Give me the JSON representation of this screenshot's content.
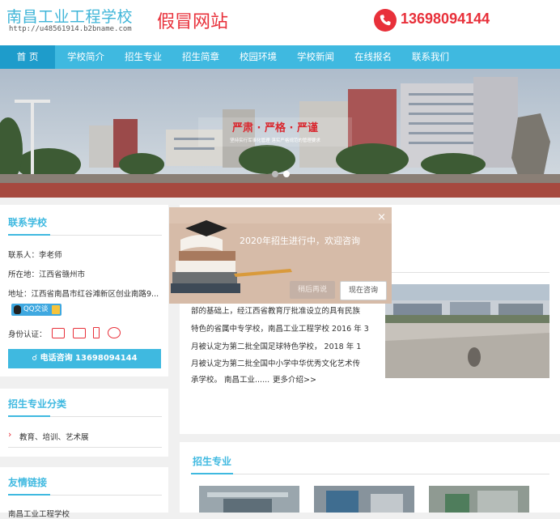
{
  "header": {
    "school_name": "南昌工业工程学校",
    "site_url": "http://u48561914.b2bname.com",
    "fake_site_label": "假冒网站",
    "phone_number": "13698094144"
  },
  "nav": {
    "items": [
      "首 页",
      "学校简介",
      "招生专业",
      "招生简章",
      "校园环境",
      "学校新闻",
      "在线报名",
      "联系我们"
    ]
  },
  "banner": {
    "slogan": "严肃 · 严格 · 严谨",
    "subtitle": "坚持实行军事化管理 落实严格规范的管理要求"
  },
  "contact": {
    "title": "联系学校",
    "contact_person": "联系人：李老师",
    "location": "所在地：江西省赣州市",
    "address": "地址：江西省南昌市红谷滩新区创业南路9...",
    "qq_label": "QQ交谈",
    "id_label": "身份认证：",
    "phone_button": "电话咨询 13698094144"
  },
  "categories": {
    "title": "招生专业分类",
    "items": [
      "教育、培训、艺术展"
    ]
  },
  "links": {
    "title": "友情链接",
    "first_item": "南昌工业工程学校"
  },
  "about": {
    "lines": [
      "部的基础上，经江西省教育厅批准设立的具有民族",
      "特色的省属中专学校，南昌工业工程学校 2016 年 3",
      "月被认定为第二批全国足球特色学校， 2018 年 1",
      "月被认定为第二批全国中小学中华优秀文化艺术传",
      "承学校。 南昌工业......"
    ],
    "more_link": "更多介绍>>"
  },
  "majors": {
    "title": "招生专业"
  },
  "modal": {
    "message": "2020年招生进行中，欢迎咨询",
    "later_button": "稍后再说",
    "now_button": "现在咨询",
    "close_symbol": "×"
  },
  "colors": {
    "accent": "#3fb9e0",
    "nav_active": "#1e9ccb",
    "warning_red": "#e8303a"
  }
}
